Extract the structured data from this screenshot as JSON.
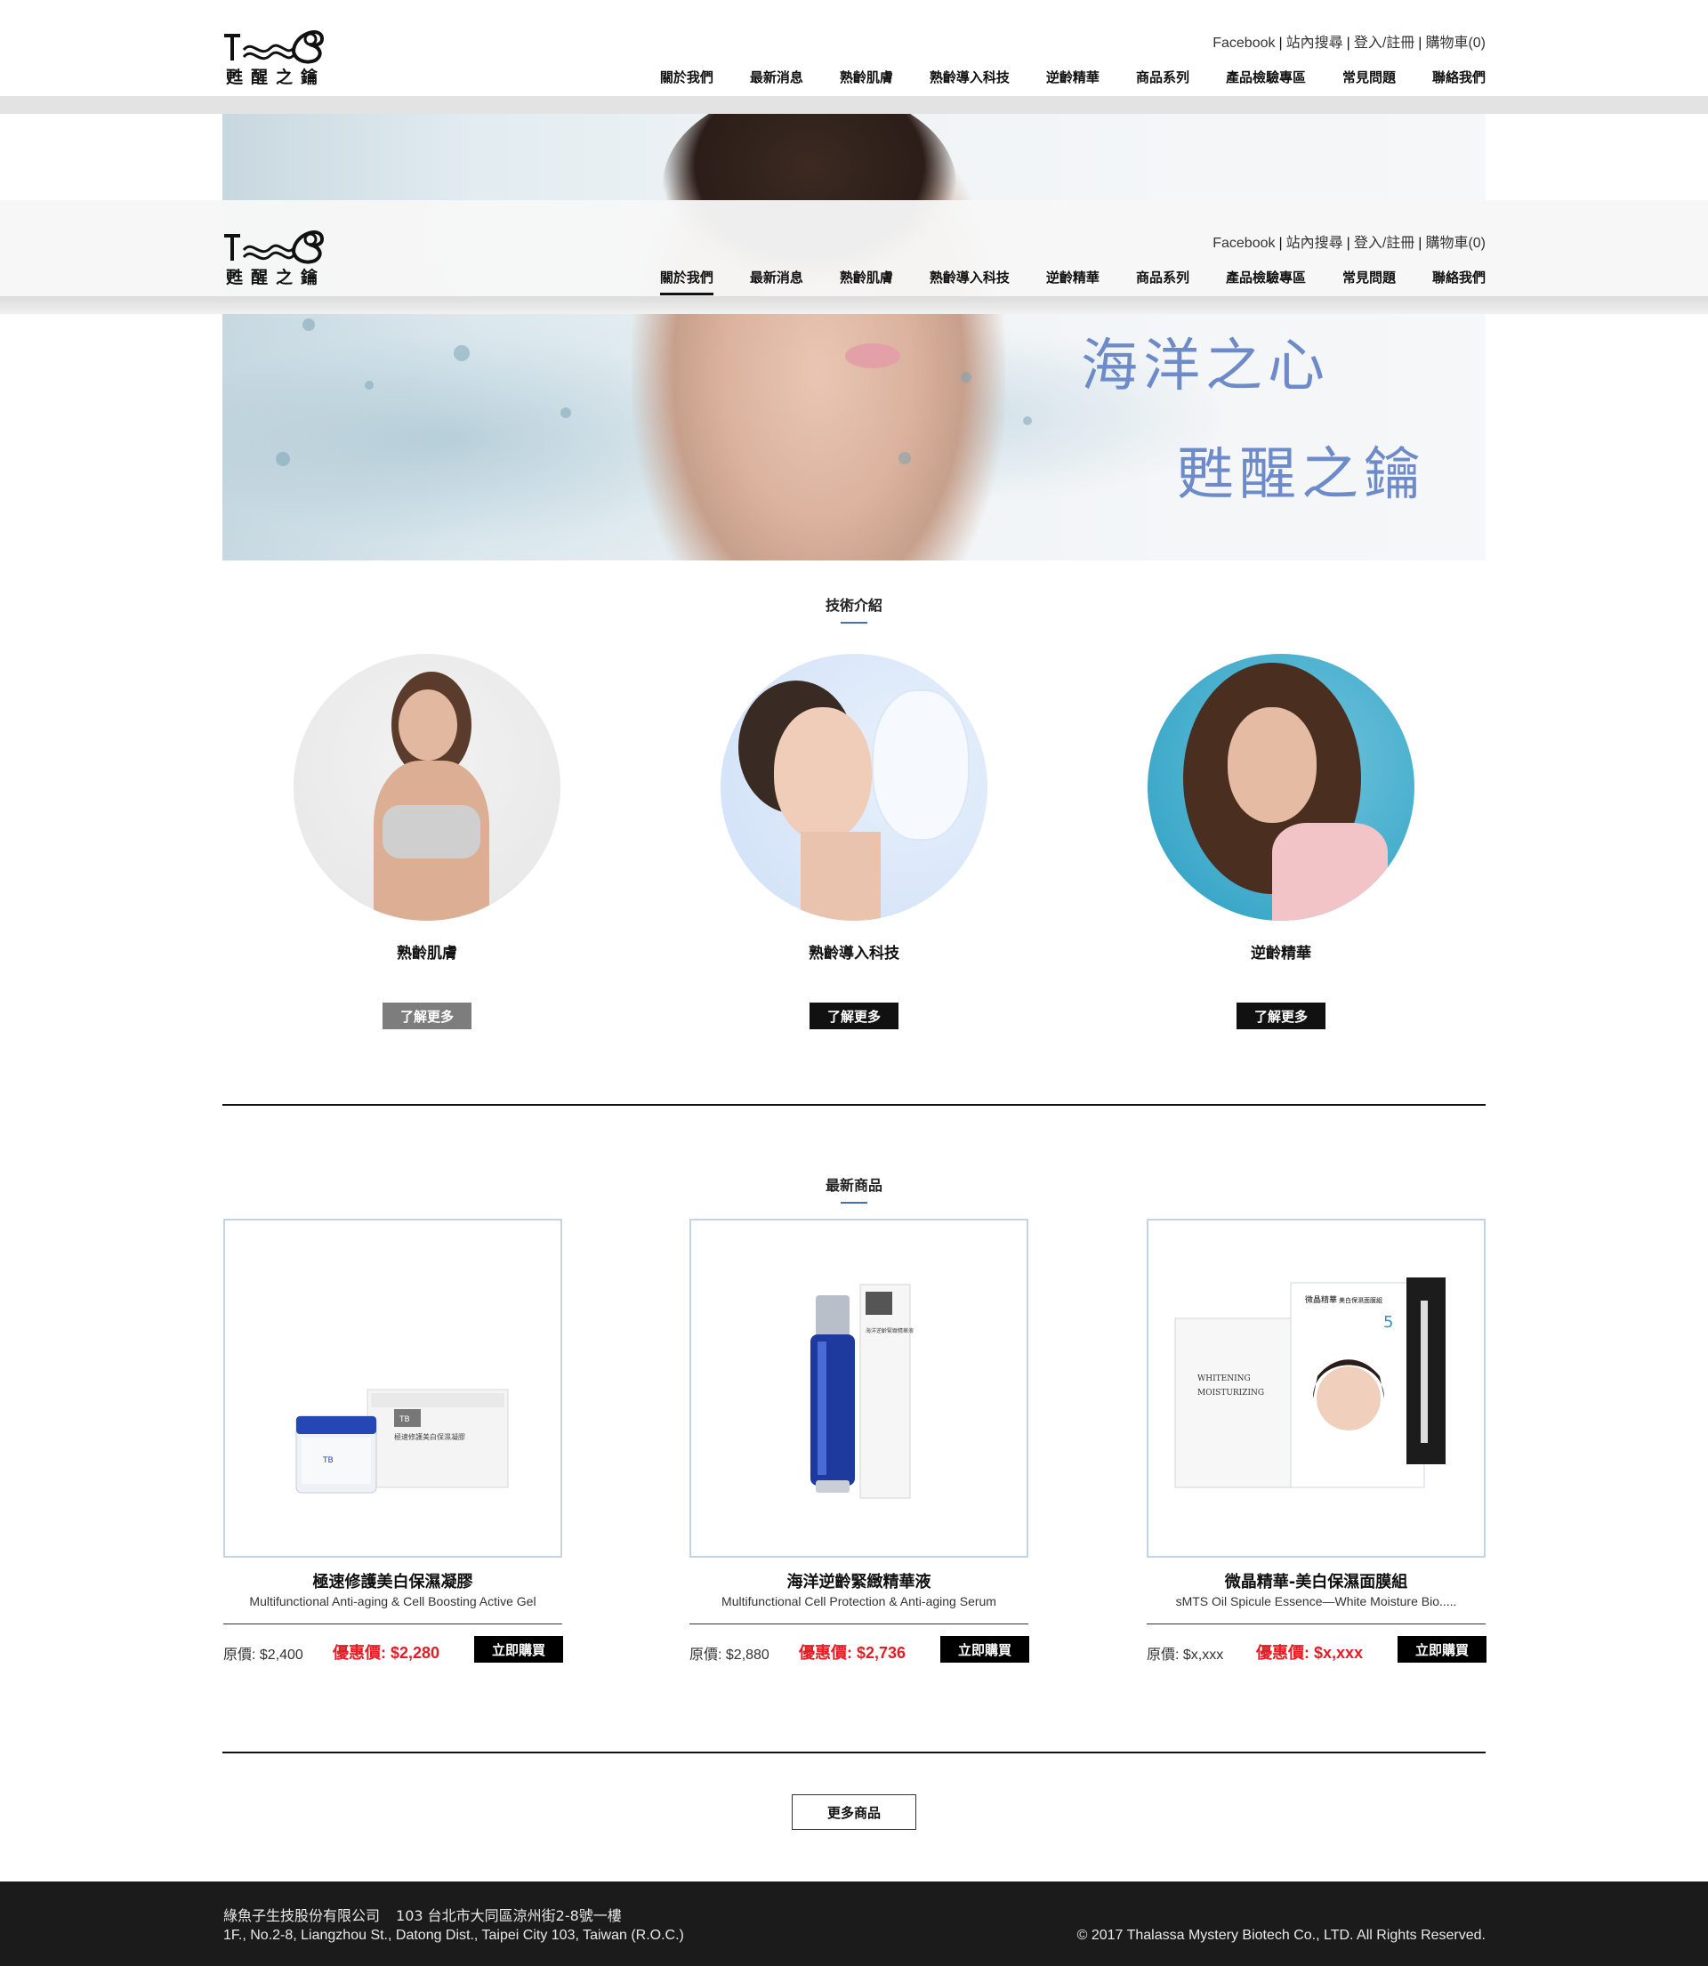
{
  "brand": {
    "logo_text": "甦醒之鑰"
  },
  "top_links": {
    "facebook": "Facebook",
    "search": "站內搜尋",
    "login": "登入/註冊",
    "cart": "購物車(0)"
  },
  "nav": [
    "關於我們",
    "最新消息",
    "熟齡肌膚",
    "熟齡導入科技",
    "逆齡精華",
    "商品系列",
    "產品檢驗專區",
    "常見問題",
    "聯絡我們"
  ],
  "hero": {
    "slogan_line1": "海洋之心",
    "slogan_line2": "甦醒之鑰"
  },
  "tech_section": {
    "title": "技術介紹",
    "items": [
      {
        "label": "熟齡肌膚",
        "button": "了解更多"
      },
      {
        "label": "熟齡導入科技",
        "button": "了解更多"
      },
      {
        "label": "逆齡精華",
        "button": "了解更多"
      }
    ]
  },
  "products_section": {
    "title": "最新商品",
    "items": [
      {
        "name": "極速修護美白保濕凝膠",
        "name_en": "Multifunctional Anti-aging & Cell Boosting Active Gel",
        "orig_price": "原價: $2,400",
        "sale_price": "優惠價: $2,280",
        "buy": "立即購買"
      },
      {
        "name": "海洋逆齡緊緻精華液",
        "name_en": "Multifunctional Cell Protection & Anti-aging Serum",
        "orig_price": "原價: $2,880",
        "sale_price": "優惠價: $2,736",
        "buy": "立即購買"
      },
      {
        "name": "微晶精華-美白保濕面膜組",
        "name_en": "sMTS Oil Spicule Essence—White Moisture Bio.....",
        "orig_price": "原價: $x,xxx",
        "sale_price": "優惠價: $x,xxx",
        "buy": "立即購買"
      }
    ],
    "more_button": "更多商品"
  },
  "product_art": {
    "gel_box": "極速修護美白保濕凝膠",
    "serum_box": "海洋逆齡緊緻精華液",
    "mask_title": "微晶精華",
    "mask_sub": "美白保濕面膜組",
    "mask_whitening": "WHITENING",
    "mask_moisturizing": "MOISTURIZING",
    "mask_count": "5"
  },
  "footer": {
    "company": "綠魚子生技股份有限公司",
    "address_zh": "103 台北市大同區涼州街2-8號一樓",
    "address_en": "1F., No.2-8, Liangzhou St., Datong Dist., Taipei City 103, Taiwan (R.O.C.)",
    "copyright": "© 2017 Thalassa Mystery Biotech Co., LTD. All Rights Reserved."
  },
  "colors": {
    "accent_blue": "#6e8bc9",
    "sale_red": "#e41d24",
    "footer_bg": "#1b1b1b",
    "product_border": "#c5d3e6"
  }
}
